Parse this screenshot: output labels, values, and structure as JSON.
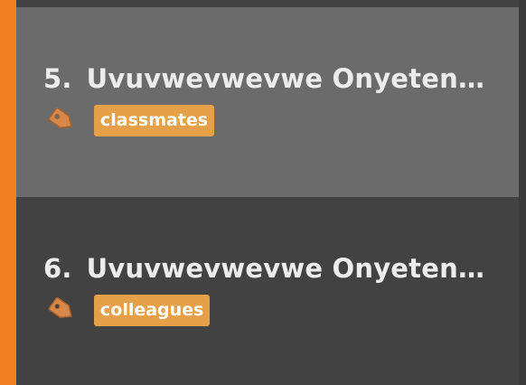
{
  "colors": {
    "accent": "#f0801f",
    "selected_bg": "#6b6b6b",
    "list_bg": "#424242",
    "tag_badge": "#e6a048",
    "tag_icon": "#d9884a"
  },
  "items": [
    {
      "number": "5.",
      "name": "Uvuvwevwevwe Onyetenye...",
      "tag_icon": "tag-icon",
      "tag": "classmates",
      "selected": true
    },
    {
      "number": "6.",
      "name": "Uvuvwevwevwe Onyetenye...",
      "tag_icon": "tag-icon",
      "tag": "colleagues",
      "selected": false
    }
  ]
}
